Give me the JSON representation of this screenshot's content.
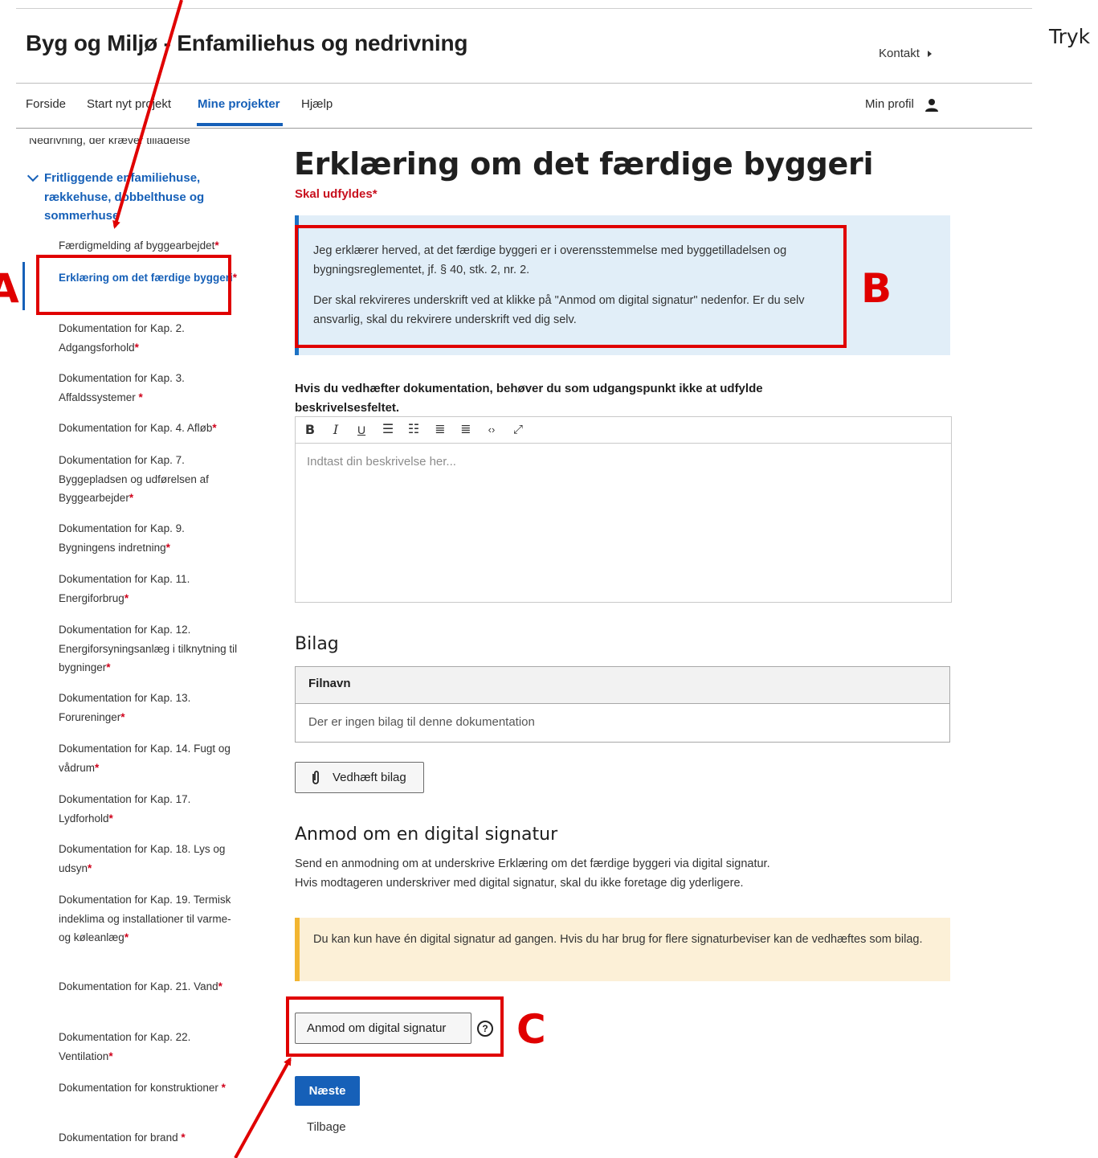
{
  "header": {
    "app_title": "Byg og Miljø - Enfamiliehus og nedrivning",
    "contact": "Kontakt",
    "side_text": "Tryk"
  },
  "nav": {
    "items": [
      "Forside",
      "Start nyt projekt",
      "Mine projekter",
      "Hjælp"
    ],
    "active": "Mine projekter",
    "profile": "Min profil"
  },
  "sidebar": {
    "clipped_item": "Nedrivning, der kræver tilladelse",
    "parent": "Fritliggende enfamiliehuse, rækkehuse, dobbelthuse og sommerhuse",
    "items": [
      {
        "text": "Færdigmelding af byggearbejdet",
        "star": "*"
      },
      {
        "text": "Erklæring om det færdige byggeri",
        "star": "*"
      },
      {
        "text": "Dokumentation for Kap. 2. Adgangsforhold",
        "star": "*"
      },
      {
        "text": "Dokumentation for Kap. 3. Affaldssystemer ",
        "star": "*"
      },
      {
        "text": "Dokumentation for Kap. 4. Afløb",
        "star": "*"
      },
      {
        "text": "Dokumentation for Kap. 7. Byggepladsen og udførelsen af Byggearbejder",
        "star": "*"
      },
      {
        "text": "Dokumentation for Kap. 9. Bygningens indretning",
        "star": "*"
      },
      {
        "text": "Dokumentation for Kap. 11. Energiforbrug",
        "star": "*"
      },
      {
        "text": "Dokumentation for Kap. 12. Energiforsyningsanlæg i tilknytning til bygninger",
        "star": "*"
      },
      {
        "text": "Dokumentation for Kap. 13. Forureninger",
        "star": "*"
      },
      {
        "text": "Dokumentation for Kap. 14. Fugt og vådrum",
        "star": "*"
      },
      {
        "text": "Dokumentation for Kap. 17. Lydforhold",
        "star": "*"
      },
      {
        "text": "Dokumentation for Kap. 18. Lys og udsyn",
        "star": "*"
      },
      {
        "text": "Dokumentation for Kap. 19. Termisk indeklima og installationer til varme- og køleanlæg",
        "star": "*"
      },
      {
        "text": "Dokumentation for Kap. 21. Vand",
        "star": "*"
      },
      {
        "text": "Dokumentation for Kap. 22. Ventilation",
        "star": "*"
      },
      {
        "text": "Dokumentation for konstruktioner ",
        "star": "*"
      },
      {
        "text": "Dokumentation for brand ",
        "star": "*"
      }
    ]
  },
  "main": {
    "title": "Erklæring om det færdige byggeri",
    "required": "Skal udfyldes*",
    "info_p1": "Jeg erklærer herved, at det færdige byggeri er i overensstemmelse med byggetilladelsen og bygningsreglementet, jf. § 40, stk. 2, nr. 2.",
    "info_p2": "Der skal rekvireres underskrift ved at klikke på \"Anmod om digital signatur\" nedenfor. Er du selv ansvarlig, skal du rekvirere underskrift ved dig selv.",
    "description_label": "Hvis du vedhæfter dokumentation, behøver du som udgangspunkt ikke at udfylde beskrivelsesfeltet.",
    "editor_placeholder": "Indtast din beskrivelse her...",
    "toolbar_icons": [
      "bold-icon",
      "italic-icon",
      "underline-icon",
      "bullet-list-icon",
      "numbered-list-icon",
      "indent-icon",
      "outdent-icon",
      "code-icon",
      "fullscreen-icon"
    ],
    "bilag_heading": "Bilag",
    "bilag_column": "Filnavn",
    "bilag_empty": "Der er ingen bilag til denne dokumentation",
    "attach_button": "Vedhæft bilag",
    "signature_heading": "Anmod om en digital signatur",
    "signature_text": "Send en anmodning om at underskrive Erklæring om det færdige byggeri via digital signatur. Hvis modtageren underskriver med digital signatur, skal du ikke foretage dig yderligere.",
    "warning": "Du kan kun have én digital signatur ad gangen. Hvis du har brug for flere signaturbeviser kan de vedhæftes som bilag.",
    "signature_button": "Anmod om digital signatur",
    "help_symbol": "?",
    "next_button": "Næste",
    "back_link": "Tilbage"
  },
  "annotations": {
    "labels": [
      "A",
      "B",
      "C"
    ],
    "color": "#e00000"
  },
  "colors": {
    "accent": "#1660b8",
    "required": "#c8101e",
    "info_bg": "#e1eef8",
    "warning_bg": "#fcf0d7"
  }
}
